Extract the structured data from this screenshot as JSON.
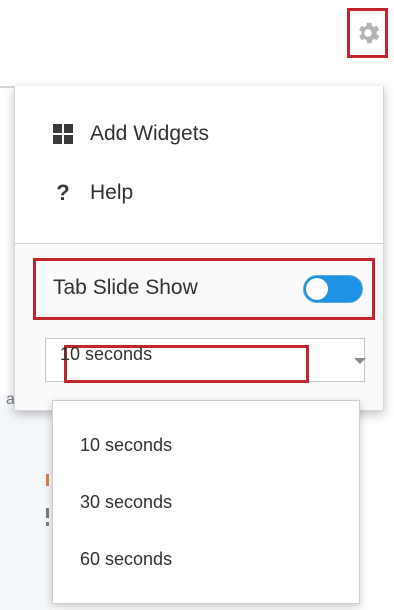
{
  "settings_button": {
    "icon": "gear-icon"
  },
  "menu": {
    "items": [
      {
        "label": "Add Widgets",
        "icon": "grid-icon"
      },
      {
        "label": "Help",
        "icon": "help-icon",
        "icon_glyph": "?"
      }
    ]
  },
  "slideshow": {
    "label": "Tab Slide Show",
    "enabled": true
  },
  "interval": {
    "selected": "10 seconds",
    "options": [
      "10 seconds",
      "30 seconds",
      "60 seconds"
    ]
  },
  "background": {
    "fragment_text": "al"
  },
  "colors": {
    "highlight_border": "#c1272d",
    "toggle_on": "#1f93e3",
    "text": "#333333"
  }
}
